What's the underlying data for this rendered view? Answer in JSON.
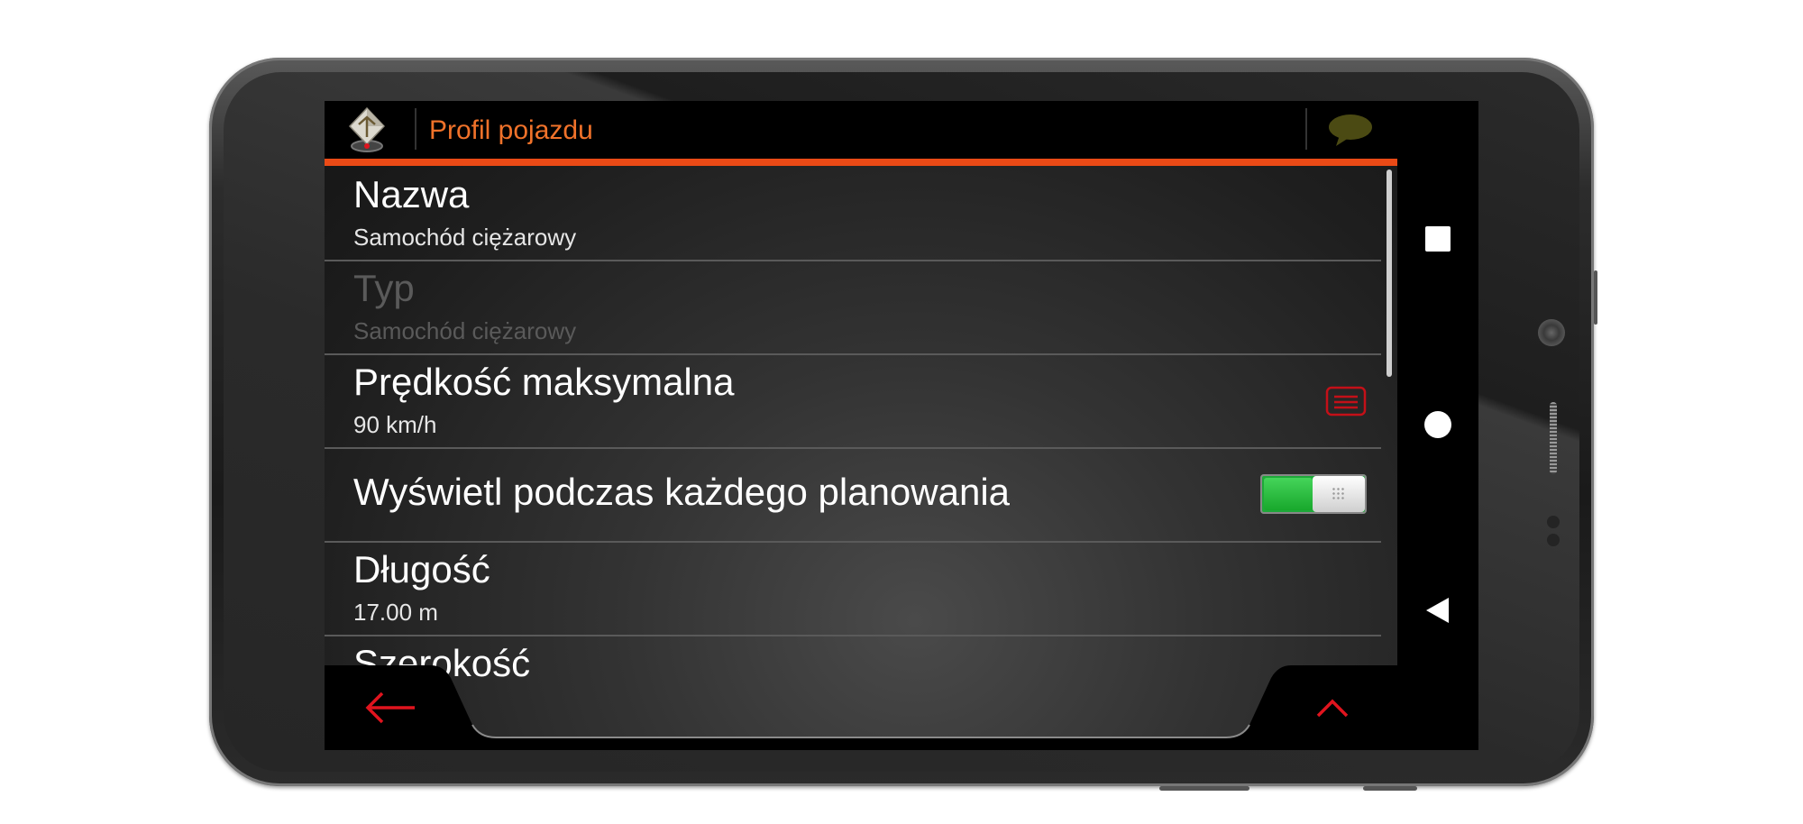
{
  "header": {
    "title": "Profil pojazdu"
  },
  "rows": [
    {
      "title": "Nazwa",
      "value": "Samochód ciężarowy"
    },
    {
      "title": "Typ",
      "value": "Samochód ciężarowy"
    },
    {
      "title": "Prędkość maksymalna",
      "value": "90 km/h"
    },
    {
      "title": "Wyświetl podczas każdego planowania"
    },
    {
      "title": "Długość",
      "value": "17.00 m"
    },
    {
      "title": "Szerokość"
    }
  ],
  "toggle": {
    "on": true
  },
  "icons": {
    "logo": "navigation-logo-icon",
    "chat": "chat-bubble-icon",
    "menu": "list-menu-icon",
    "back": "arrow-left-icon",
    "up": "chevron-up-icon",
    "nav_recent": "square-recent-icon",
    "nav_home": "circle-home-icon",
    "nav_back": "triangle-back-icon"
  },
  "colors": {
    "accent": "#f0722a",
    "bar": "#ea4a16",
    "red": "#e0141e",
    "toggle_green": "#1fa83a"
  }
}
